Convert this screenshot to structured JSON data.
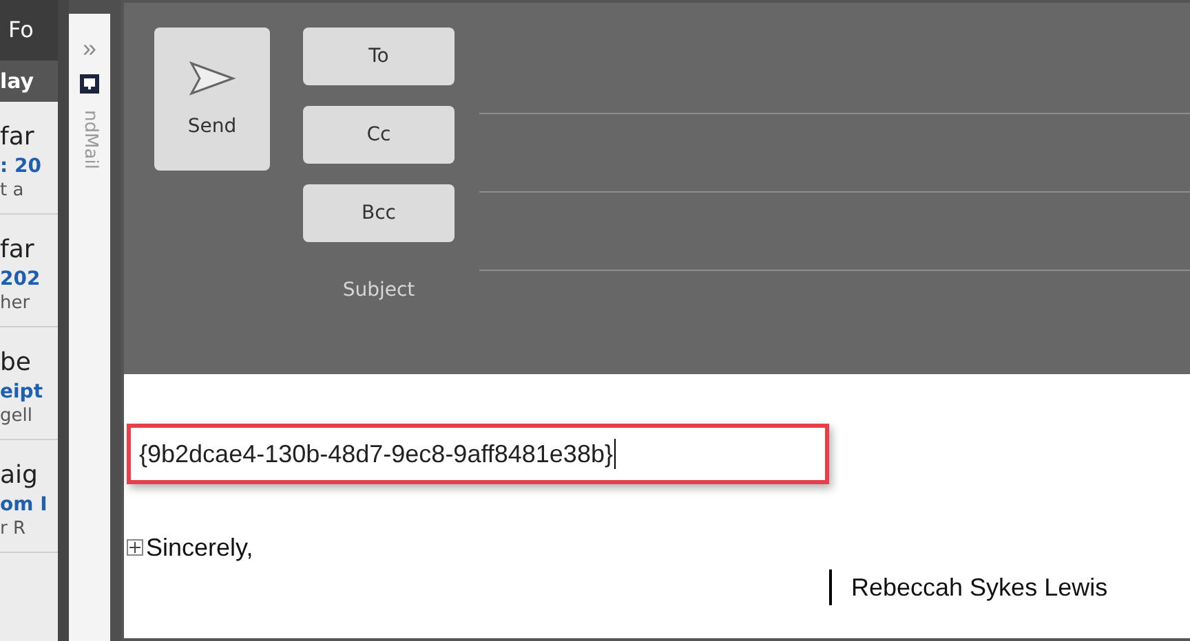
{
  "mail_list": {
    "header": "Fo",
    "day_header": "lay",
    "items": [
      {
        "sender": "far",
        "subject": ": 20",
        "preview": "t a"
      },
      {
        "sender": "far",
        "subject": "202",
        "preview": "her"
      },
      {
        "sender": "be",
        "subject": "eipt",
        "preview": "gell"
      },
      {
        "sender": "aig",
        "subject": "om I",
        "preview": "r R"
      }
    ]
  },
  "side_pane": {
    "expand": "»",
    "label": "ndMail"
  },
  "compose": {
    "send": "Send",
    "address_buttons": [
      "To",
      "Cc",
      "Bcc"
    ],
    "subject_label": "Subject",
    "body": {
      "highlighted_text": "{9b2dcae4-130b-48d7-9ec8-9aff8481e38b}",
      "closing": "Sincerely,",
      "signature": "Rebeccah Sykes Lewis"
    }
  }
}
